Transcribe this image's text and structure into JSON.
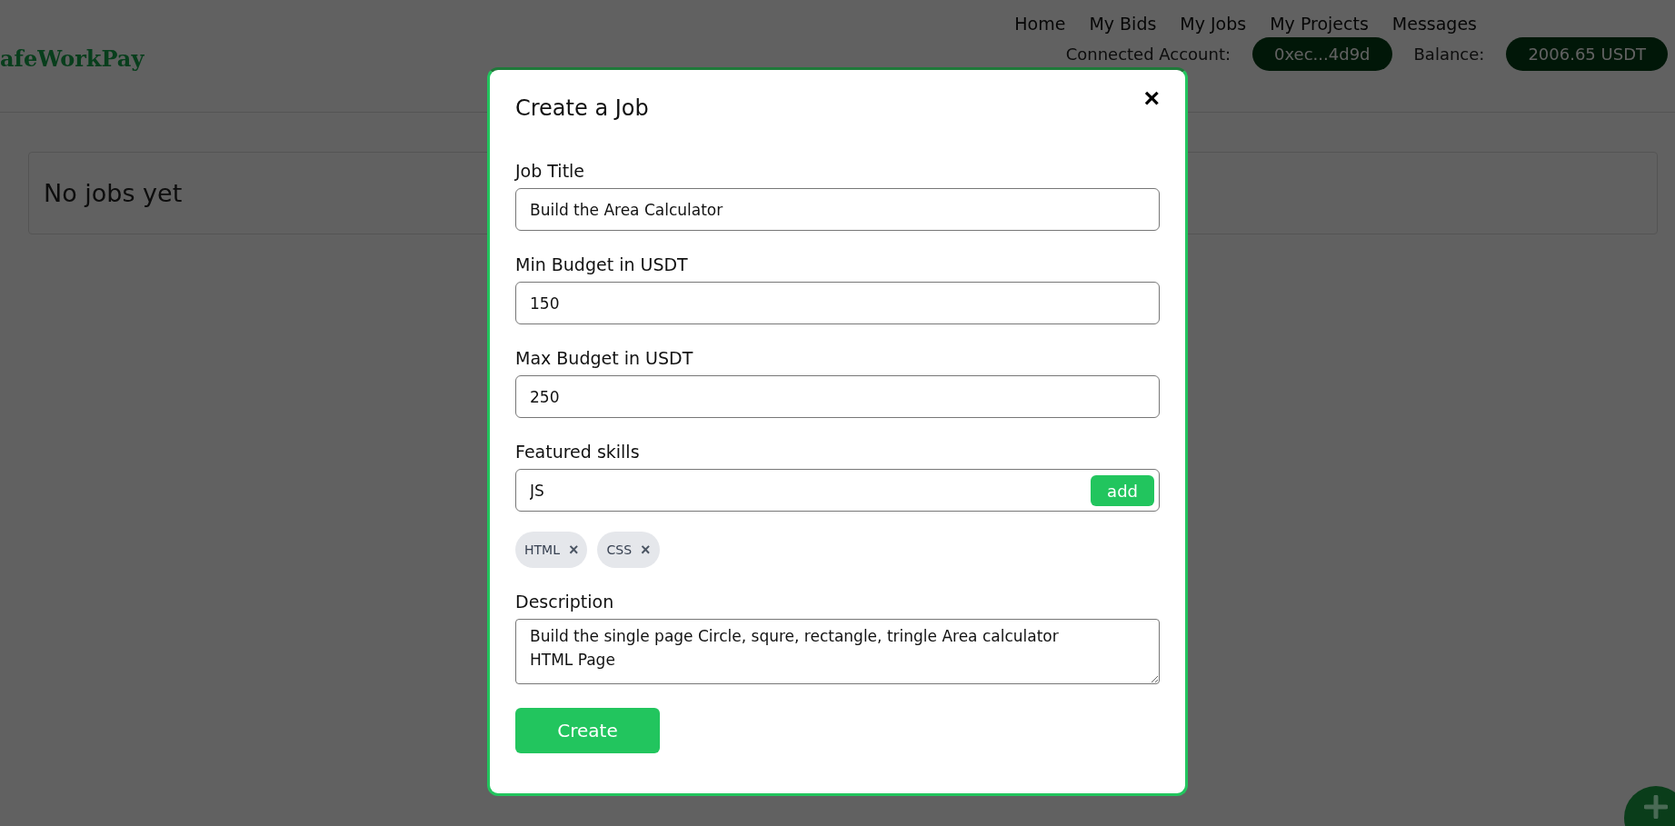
{
  "header": {
    "logo": "afeWorkPay",
    "nav": [
      "Home",
      "My Bids",
      "My Jobs",
      "My Projects",
      "Messages"
    ],
    "account_label": "Connected Account:",
    "account": "0xec...4d9d",
    "balance_label": "Balance:",
    "balance": "2006.65 USDT"
  },
  "jobs_card": {
    "text": "No jobs yet"
  },
  "modal": {
    "title": "Create a Job",
    "close": "×",
    "fields": [
      {
        "kind": "input",
        "label": "Job Title",
        "value": "Build the Area Calculator"
      },
      {
        "kind": "input",
        "label": "Min Budget in USDT",
        "value": "150"
      },
      {
        "kind": "input",
        "label": "Max Budget in USDT",
        "value": "250"
      },
      {
        "kind": "skills",
        "label": "Featured skills",
        "value": "JS",
        "button": "add",
        "tags": [
          {
            "label": "HTML",
            "remove": "×"
          },
          {
            "label": "CSS",
            "remove": "×"
          }
        ]
      },
      {
        "kind": "textarea",
        "label": "Description",
        "value": "Build the single page Circle, squre, rectangle, tringle Area calculator HTML Page"
      }
    ],
    "submit": "Create"
  }
}
